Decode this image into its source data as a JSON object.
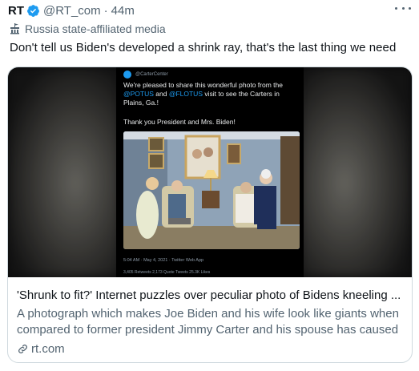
{
  "tweet": {
    "author_name": "RT",
    "author_handle": "@RT_com",
    "separator": "·",
    "time": "44m",
    "affiliation_label": "Russia state-affiliated media",
    "text": "Don't tell us Biden's developed a shrink ray, that's the last thing we need"
  },
  "card": {
    "embedded_tweet": {
      "handle": "@CarterCenter",
      "text_before": "We're pleased to share this wonderful photo from the ",
      "mention_1": "@POTUS",
      "text_middle": " and ",
      "mention_2": "@FLOTUS",
      "text_after": " visit to see the Carters in Plains, Ga.!",
      "thanks": "Thank you President and Mrs. Biden!",
      "meta": "5:04 AM · May 4, 2021 · Twitter Web App",
      "stats": "3,405 Retweets   2,173 Quote Tweets   25.3K Likes"
    },
    "title": "'Shrunk to fit?' Internet puzzles over peculiar photo of Bidens kneeling ...",
    "description": "A photograph which makes Joe Biden and his wife look like giants when compared to former president Jimmy Carter and his spouse has caused",
    "domain": "rt.com"
  },
  "colors": {
    "accent": "#1d9bf0",
    "text_primary": "#0f1419",
    "text_secondary": "#536471",
    "border": "#cfd9de"
  },
  "icons": {
    "verified": "verified-badge-icon",
    "affiliation": "state-media-flag-icon",
    "more": "more-options-icon",
    "link": "link-icon"
  }
}
